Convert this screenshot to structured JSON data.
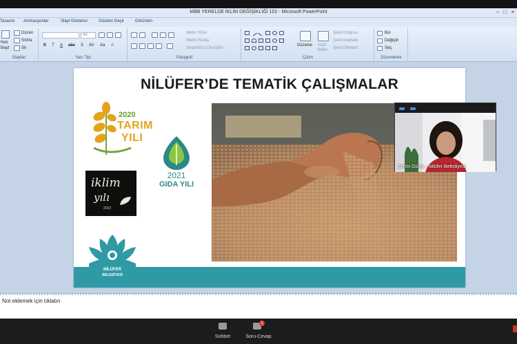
{
  "window": {
    "title": "MBB YERELDE İKLİM DEĞİŞİKLİĞİ 101 - Microsoft PowerPoint",
    "buttons": [
      "–",
      "□",
      "×"
    ]
  },
  "menu_tabs": [
    "Tasarım",
    "Animasyonlar",
    "Slayt Gösterisi",
    "Gözden Geçir",
    "Görünüm"
  ],
  "ribbon": {
    "slides": {
      "label": "Slaytlar",
      "new_slide": [
        "Yeni",
        "Slayt"
      ],
      "layout": "Düzen",
      "reset": "Sıfırla",
      "delete": "Sil"
    },
    "font": {
      "label": "Yazı Tipi",
      "size": "40"
    },
    "paragraph": {
      "label": "Paragraf",
      "text_direction": "Metin Yönü",
      "align_text": "Metni Hizala",
      "smartart": "SmartArt'a Dönüştür"
    },
    "drawing": {
      "label": "Çizim",
      "arrange": "Düzenle",
      "quick_styles": [
        "Hızlı",
        "Stiller"
      ],
      "fill": "Şekil Dolgusu",
      "outline": "Şekil Anahattı",
      "effects": "Şekil Efektleri"
    },
    "editing": {
      "label": "Düzenleme",
      "find": "Bul",
      "replace": "Değiştir",
      "select": "Seç"
    }
  },
  "slide": {
    "title": "NİLÜFER’DE TEMATİK ÇALIŞMALAR",
    "logo_tarim": {
      "year": "2020",
      "line1": "TARIM",
      "line2": "YILI"
    },
    "logo_gida": {
      "year": "2021",
      "name": "GIDA YILI"
    },
    "logo_iklim": {
      "line1": "iklim",
      "line2": "yılı",
      "year": "2022"
    },
    "logo_nilufer": {
      "line1": "NİLÜFER",
      "line2": "BELEDİYESİ"
    }
  },
  "video": {
    "participant": "Zerrin Güleş - Nilüfer Belediyesi"
  },
  "notes": {
    "placeholder": "Not eklemek için tıklatın"
  },
  "bottom_bar": {
    "chat_label": "Sohbet",
    "qa_label": "Soru-Cevap",
    "qa_badge": "1"
  },
  "colors": {
    "tarim_gold": "#e3a41c",
    "gida_teal": "#2b8a86",
    "band_teal": "#2f9aa6",
    "zoom_blue": "#3b8ed8"
  }
}
